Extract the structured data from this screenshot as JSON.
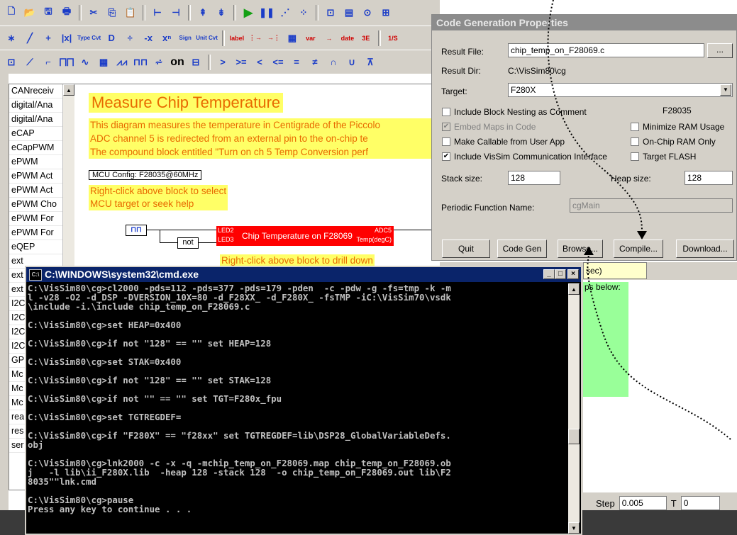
{
  "toolbar": {
    "row1": [
      {
        "icon": "new-file-icon",
        "glyph": "🗋"
      },
      {
        "icon": "open-icon",
        "glyph": "📂"
      },
      {
        "icon": "save-icon",
        "glyph": "🖫"
      },
      {
        "icon": "print-icon",
        "glyph": "🖶"
      },
      {
        "sep": true
      },
      {
        "icon": "cut-icon",
        "glyph": "✂"
      },
      {
        "icon": "copy-icon",
        "glyph": "⎘"
      },
      {
        "icon": "paste-icon",
        "glyph": "📋"
      },
      {
        "sep": true
      },
      {
        "icon": "add-connector-icon",
        "glyph": "⊢"
      },
      {
        "icon": "remove-connector-icon",
        "glyph": "⊣"
      },
      {
        "sep": true
      },
      {
        "icon": "align-top-icon",
        "glyph": "⇞"
      },
      {
        "icon": "flip-icon",
        "glyph": "⇟"
      },
      {
        "sep": true
      },
      {
        "icon": "run-icon",
        "glyph": "▶",
        "cls": "green"
      },
      {
        "icon": "pause-icon",
        "glyph": "❚❚"
      },
      {
        "icon": "step-icon",
        "glyph": "⋰"
      },
      {
        "icon": "break-icon",
        "glyph": "⁘"
      },
      {
        "sep": true
      },
      {
        "icon": "probe-icon",
        "glyph": "⊡"
      },
      {
        "icon": "plot-icon",
        "glyph": "▤"
      },
      {
        "icon": "monitor-icon",
        "glyph": "⊙"
      },
      {
        "icon": "compile-icon",
        "glyph": "⊞"
      }
    ],
    "row2": [
      {
        "icon": "gain-block-icon",
        "glyph": "∗"
      },
      {
        "icon": "slope-icon",
        "glyph": "╱"
      },
      {
        "icon": "sum-block-icon",
        "glyph": "+"
      },
      {
        "icon": "abs-block-icon",
        "glyph": "|x|"
      },
      {
        "icon": "type-convert-icon",
        "small": true,
        "text": "Type Cvt"
      },
      {
        "icon": "divide-block-icon",
        "glyph": "D"
      },
      {
        "icon": "fraction-block-icon",
        "glyph": "÷"
      },
      {
        "icon": "negate-block-icon",
        "glyph": "-x"
      },
      {
        "icon": "power-block-icon",
        "glyph": "xⁿ"
      },
      {
        "icon": "sign-block-icon",
        "small": true,
        "text": "Sign"
      },
      {
        "icon": "unit-convert-icon",
        "small": true,
        "text": "Unit Cvt"
      },
      {
        "sep": true
      },
      {
        "icon": "label-block-icon",
        "text": "label",
        "cls": "red"
      },
      {
        "icon": "bus-split-icon",
        "glyph": "⋮→",
        "cls": "red"
      },
      {
        "icon": "bus-merge-icon",
        "glyph": "→⋮",
        "cls": "red"
      },
      {
        "icon": "table-block-icon",
        "glyph": "▦"
      },
      {
        "icon": "variable-block-icon",
        "text": "var",
        "cls": "red"
      },
      {
        "icon": "wire-block-icon",
        "glyph": "→",
        "cls": "red"
      },
      {
        "icon": "date-block-icon",
        "text": "date",
        "cls": "red"
      },
      {
        "icon": "display-block-icon",
        "text": "3E",
        "cls": "red"
      },
      {
        "sep": true
      },
      {
        "icon": "reciprocal-block-icon",
        "text": "1/S",
        "cls": "red"
      }
    ],
    "row3": [
      {
        "icon": "const-block-icon",
        "glyph": "⊡"
      },
      {
        "icon": "ramp-block-icon",
        "glyph": "⟋"
      },
      {
        "icon": "step-block-icon",
        "glyph": "⌐"
      },
      {
        "icon": "pulse-train-icon",
        "glyph": "⨅⨅"
      },
      {
        "icon": "sine-block-icon",
        "glyph": "∿"
      },
      {
        "icon": "matrix-block-icon",
        "glyph": "▦"
      },
      {
        "icon": "sawtooth-block-icon",
        "glyph": "⩘⩘"
      },
      {
        "icon": "square-wave-icon",
        "glyph": "⊓⊓"
      },
      {
        "icon": "noise-block-icon",
        "glyph": "⩫"
      },
      {
        "icon": "onoff-block-icon",
        "text": "on",
        "cls": "black"
      },
      {
        "icon": "digital-display-icon",
        "glyph": "⊟"
      },
      {
        "sep": true
      },
      {
        "icon": "greater-than-icon",
        "glyph": ">"
      },
      {
        "icon": "greater-equal-icon",
        "glyph": ">="
      },
      {
        "icon": "less-than-icon",
        "glyph": "<"
      },
      {
        "icon": "less-equal-icon",
        "glyph": "<="
      },
      {
        "icon": "equal-icon",
        "glyph": "="
      },
      {
        "icon": "not-equal-icon",
        "glyph": "≠"
      },
      {
        "icon": "and-icon",
        "glyph": "∩"
      },
      {
        "icon": "or-icon",
        "glyph": "∪"
      },
      {
        "icon": "xor-icon",
        "glyph": "⊼"
      }
    ]
  },
  "left_panel": {
    "items": [
      "CANreceiv",
      "digital/Ana",
      "digital/Ana",
      "eCAP",
      "eCapPWM",
      "ePWM",
      "ePWM Act",
      "ePWM Act",
      "ePWM Cho",
      "ePWM For",
      "ePWM For",
      "eQEP",
      "ext",
      "ext",
      "ext",
      "I2C",
      "I2C",
      "I2C",
      "I2C",
      "GPI",
      "Mc",
      "Mc",
      "Mc",
      "rea",
      "res",
      "ser"
    ]
  },
  "diagram": {
    "title": "Measure Chip Temperature",
    "description": [
      "This diagram measures the temperature in Centigrade of the Piccolo",
      "ADC channel 5 is redirected from an external pin to the on-chip te",
      "The compound block entitled \"Turn on ch 5 Temp Conversion perf"
    ],
    "mcu_config": "MCU Config: F28035@60MHz",
    "mcu_note": [
      "Right-click above block to select",
      "MCU target or seek help"
    ],
    "pulse_label": "⊓⊓",
    "not_label": "not",
    "chip_block": {
      "title": "Chip Temperature on F28069",
      "in1": "LED2",
      "in2": "LED3",
      "out1": "ADC5",
      "out2": "Temp(degC)"
    },
    "drill_note": "Right-click above block to drill down"
  },
  "dialog": {
    "title": "Code Generation Properties",
    "result_file_label": "Result File:",
    "result_file_value": "chip_temp_on_F28069.c",
    "browse_dots": "...",
    "result_dir_label": "Result Dir:",
    "result_dir_value": "C:\\VisSim80\\cg",
    "target_label": "Target:",
    "target_value": "F280X",
    "target_chip": "F28035",
    "checkboxes": {
      "block_nesting": {
        "label": "Include Block Nesting as Comment",
        "checked": false
      },
      "embed_maps": {
        "label": "Embed Maps in Code",
        "checked": true,
        "disabled": true
      },
      "callable": {
        "label": "Make Callable from User App",
        "checked": false
      },
      "vissim_comm": {
        "label": "Include VisSim Communication Interface",
        "checked": true
      },
      "min_ram": {
        "label": "Minimize RAM Usage",
        "checked": false
      },
      "onchip_ram": {
        "label": "On-Chip RAM Only",
        "checked": false
      },
      "target_flash": {
        "label": "Target FLASH",
        "checked": false
      }
    },
    "stack_label": "Stack size:",
    "stack_value": "128",
    "heap_label": "Heap size:",
    "heap_value": "128",
    "periodic_label": "Periodic Function Name:",
    "periodic_value": "cgMain",
    "buttons": {
      "quit": "Quit",
      "codegen": "Code Gen",
      "browse": "Browse...",
      "compile": "Compile...",
      "download": "Download..."
    }
  },
  "right_area": {
    "tooltip": "sec)",
    "green_text": "ps below:",
    "step_label": "Step",
    "step_value": "0.005",
    "t_label": "T",
    "t_value": "0"
  },
  "cmd": {
    "icon_text": "C:\\",
    "title": "C:\\WINDOWS\\system32\\cmd.exe",
    "min": "_",
    "max": "□",
    "close": "×",
    "lines": [
      "C:\\VisSim80\\cg>cl2000 -pds=112 -pds=377 -pds=179 -pden  -c -pdw -g -fs=tmp -k -m",
      "l -v28 -O2 -d_DSP -DVERSION_10X=80 -d_F28XX_ -d_F280X_ -fsTMP -iC:\\VisSim70\\vsdk",
      "\\include -i.\\include chip_temp_on_F28069.c",
      "",
      "C:\\VisSim80\\cg>set HEAP=0x400",
      "",
      "C:\\VisSim80\\cg>if not \"128\" == \"\" set HEAP=128",
      "",
      "C:\\VisSim80\\cg>set STAK=0x400",
      "",
      "C:\\VisSim80\\cg>if not \"128\" == \"\" set STAK=128",
      "",
      "C:\\VisSim80\\cg>if not \"\" == \"\" set TGT=F280x_fpu",
      "",
      "C:\\VisSim80\\cg>set TGTREGDEF=",
      "",
      "C:\\VisSim80\\cg>if \"F280X\" == \"f28xx\" set TGTREGDEF=lib\\DSP28_GlobalVariableDefs.",
      "obj",
      "",
      "C:\\VisSim80\\cg>lnk2000 -c -x -q -mchip_temp_on_F28069.map chip_temp_on_F28069.ob",
      "j   -l lib\\ii_F280X.lib  -heap 128 -stack 128  -o chip_temp_on_F28069.out lib\\F2",
      "8035\"\"lnk.cmd",
      "",
      "C:\\VisSim80\\cg>pause",
      "Press any key to continue . . ."
    ]
  },
  "colors": {
    "note_bg": "#ffff66",
    "note_text": "#e86a00",
    "chip_block": "#ff0000",
    "cmd_title": "#0a246a",
    "green_area": "#99ff99"
  }
}
